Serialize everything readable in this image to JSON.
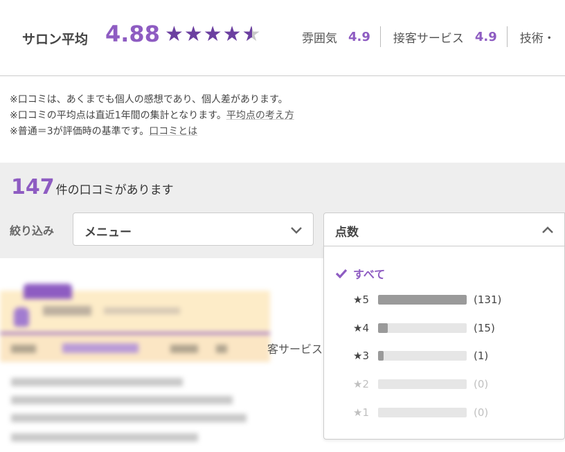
{
  "rating": {
    "label": "サロン平均",
    "score": "4.88",
    "stars_full": "★★★★",
    "star_half": "★",
    "sub_scores": [
      {
        "label": "雰囲気",
        "value": "4.9"
      },
      {
        "label": "接客サービス",
        "value": "4.9"
      },
      {
        "label": "技術・",
        "value": ""
      }
    ]
  },
  "notes": {
    "line1": "※口コミは、あくまでも個人の感想であり、個人差があります。",
    "line2_text": "※口コミの平均点は直近1年間の集計となります。",
    "line2_link": "平均点の考え方",
    "line3_text": "※普通＝3が評価時の基準です。",
    "line3_link": "口コミとは"
  },
  "reviews": {
    "count": "147",
    "count_suffix": "件の口コミがあります"
  },
  "filter": {
    "label": "絞り込み",
    "menu_select": "メニュー",
    "score_select": "点数"
  },
  "score_options": {
    "all_label": "すべて",
    "items": [
      {
        "label": "★5",
        "count": "(131)",
        "fraction": 1.0,
        "enabled": true
      },
      {
        "label": "★4",
        "count": "(15)",
        "fraction": 0.11,
        "enabled": true
      },
      {
        "label": "★3",
        "count": "(1)",
        "fraction": 0.05,
        "enabled": true
      },
      {
        "label": "★2",
        "count": "(0)",
        "fraction": 0,
        "enabled": false
      },
      {
        "label": "★1",
        "count": "(0)",
        "fraction": 0,
        "enabled": false
      }
    ]
  },
  "partial_text": "客サービス",
  "colors": {
    "accent": "#8e5cc2",
    "star": "#6b3fa0",
    "bar_fill": "#9a9a9a",
    "bar_track": "#e6e6e6"
  }
}
